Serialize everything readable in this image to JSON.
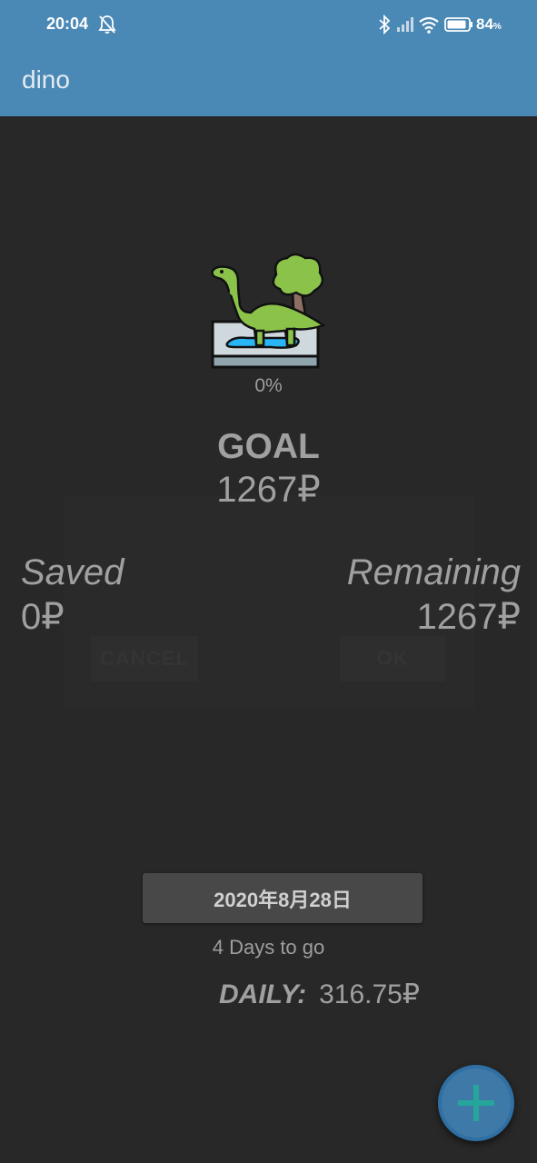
{
  "status_bar": {
    "time": "20:04",
    "battery_level": "84",
    "battery_unit": "%",
    "icons": [
      "bell-off-icon",
      "bluetooth-icon",
      "signal-icon",
      "wifi-icon",
      "battery-icon"
    ]
  },
  "app_bar": {
    "title": "dino",
    "color": "#4a88b5"
  },
  "ghost_dialog": {
    "cancel_label": "CANCEL",
    "ok_label": "OK"
  },
  "progress": {
    "text": "0%",
    "fraction": 0
  },
  "goal": {
    "label": "GOAL",
    "value": "1267₽"
  },
  "saved": {
    "label": "Saved",
    "value": "0₽"
  },
  "remaining": {
    "label": "Remaining",
    "value": "1267₽"
  },
  "date_button": {
    "label": "2020年8月28日"
  },
  "days_to_go": "4 Days to go",
  "daily": {
    "label": "DAILY:",
    "value": "316.75₽"
  },
  "fab": {
    "icon": "plus-icon",
    "plus_color": "#26a69a"
  }
}
